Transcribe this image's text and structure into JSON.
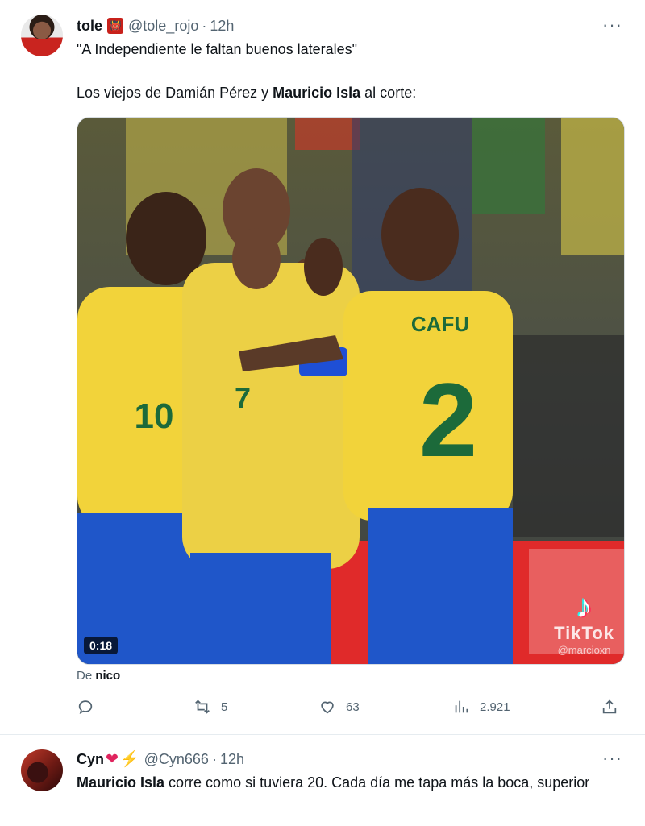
{
  "tweet": {
    "author_name": "tole",
    "author_badge": "👹",
    "handle": "@tole_rojo",
    "separator": "·",
    "time": "12h",
    "more": "···",
    "quote_line": "\"A Independiente le faltan buenos laterales\"",
    "line2_prefix": "Los viejos de Damián Pérez y ",
    "line2_bold": "Mauricio Isla",
    "line2_suffix": " al corte:",
    "video": {
      "duration": "0:18",
      "tiktok_mark": "♪",
      "tiktok_label": "TikTok",
      "tiktok_user": "@marcioxn",
      "jersey_name": "CAFU",
      "jersey_number": "2",
      "jersey_number_left": "10",
      "jersey_number_mid": "7"
    },
    "attribution_prefix": "De ",
    "attribution_name": "nico",
    "actions": {
      "replies": "",
      "retweets": "5",
      "likes": "63",
      "views": "2.921"
    }
  },
  "reply": {
    "author_name": "Cyn",
    "heart": "❤",
    "bolt": "⚡",
    "handle": "@Cyn666",
    "separator": "·",
    "time": "12h",
    "more": "···",
    "text_bold": "Mauricio Isla",
    "text_rest": " corre como si tuviera 20. Cada día me tapa más la boca, superior"
  },
  "icons": [
    "reply-icon",
    "retweet-icon",
    "like-icon",
    "views-icon",
    "share-icon",
    "more-icon"
  ],
  "colors": {
    "secondary_text": "#536471",
    "primary_text": "#0f1419",
    "jersey_yellow": "#f2d33a",
    "shorts_blue": "#1f56c9",
    "armband_blue": "#1e4fd6"
  }
}
